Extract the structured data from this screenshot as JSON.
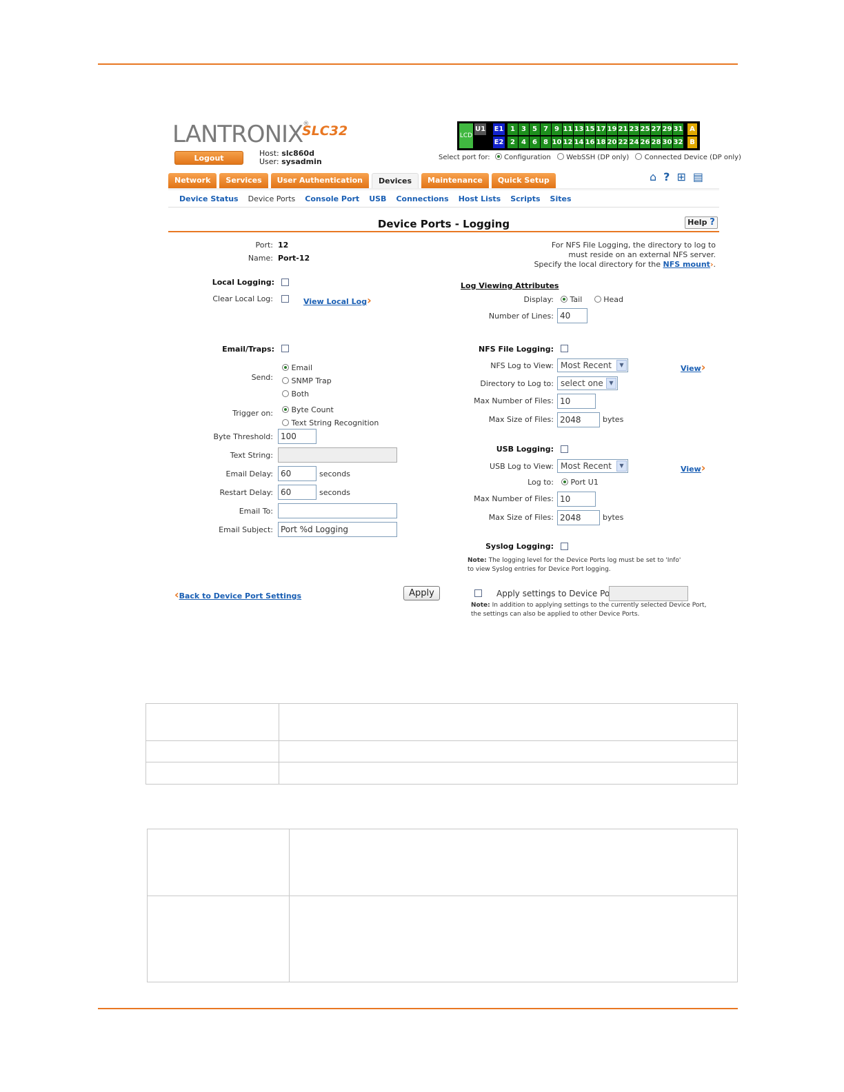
{
  "brand": {
    "logo_main": "LANTRONIX",
    "logo_reg": "®",
    "model": "SLC32"
  },
  "session": {
    "logout_label": "Logout",
    "host_label": "Host:",
    "host_value": "slc860d",
    "user_label": "User:",
    "user_value": "sysadmin"
  },
  "portmap": {
    "lcd": "LCD",
    "u1": "U1",
    "e1": "E1",
    "e2": "E2",
    "top_ports": [
      "1",
      "3",
      "5",
      "7",
      "9",
      "11",
      "13",
      "15",
      "17",
      "19",
      "21",
      "23",
      "25",
      "27",
      "29",
      "31"
    ],
    "bottom_ports": [
      "2",
      "4",
      "6",
      "8",
      "10",
      "12",
      "14",
      "16",
      "18",
      "20",
      "22",
      "24",
      "26",
      "28",
      "30",
      "32"
    ],
    "a": "A",
    "b": "B"
  },
  "select_port": {
    "label": "Select port for:",
    "options": [
      "Configuration",
      "WebSSH (DP only)",
      "Connected Device (DP only)"
    ],
    "selected": "Configuration"
  },
  "tabs": [
    "Network",
    "Services",
    "User Authentication",
    "Devices",
    "Maintenance",
    "Quick Setup"
  ],
  "active_tab": "Devices",
  "icons": [
    "home-icon",
    "help-icon",
    "sitemap-icon",
    "notes-icon"
  ],
  "subnav": [
    "Device Status",
    "Device Ports",
    "Console Port",
    "USB",
    "Connections",
    "Host Lists",
    "Scripts",
    "Sites"
  ],
  "current_subnav": "Device Ports",
  "page": {
    "title": "Device Ports - Logging",
    "help_label": "Help",
    "help_q": "?"
  },
  "port_info": {
    "port_label": "Port:",
    "port_value": "12",
    "name_label": "Name:",
    "name_value": "Port-12"
  },
  "nfs_hint": {
    "line1": "For NFS File Logging, the directory to log to",
    "line2": "must reside on an external NFS server.",
    "line3": "Specify the local directory for the",
    "link": "NFS mount",
    "end": "."
  },
  "local": {
    "local_logging_label": "Local Logging:",
    "clear_label": "Clear Local Log:",
    "view_link": "View Local Log"
  },
  "log_view": {
    "heading": "Log Viewing Attributes",
    "display_label": "Display:",
    "tail": "Tail",
    "head": "Head",
    "display_selected": "Tail",
    "lines_label": "Number of Lines:",
    "lines_value": "40"
  },
  "email": {
    "traps_label": "Email/Traps:",
    "send_label": "Send:",
    "send_options": [
      "Email",
      "SNMP Trap",
      "Both"
    ],
    "send_selected": "Email",
    "trigger_label": "Trigger on:",
    "trigger_options": [
      "Byte Count",
      "Text String Recognition"
    ],
    "trigger_selected": "Byte Count",
    "threshold_label": "Byte Threshold:",
    "threshold_value": "100",
    "text_string_label": "Text String:",
    "text_string_value": "",
    "delay_label": "Email Delay:",
    "delay_value": "60",
    "delay_unit": "seconds",
    "restart_label": "Restart Delay:",
    "restart_value": "60",
    "restart_unit": "seconds",
    "to_label": "Email To:",
    "to_value": "",
    "subject_label": "Email Subject:",
    "subject_value": "Port %d Logging"
  },
  "nfs": {
    "label": "NFS File Logging:",
    "log_view_label": "NFS Log to View:",
    "log_view_value": "Most Recent",
    "view_link": "View",
    "dir_label": "Directory to Log to:",
    "dir_value": "select one",
    "max_files_label": "Max Number of Files:",
    "max_files_value": "10",
    "max_size_label": "Max Size of Files:",
    "max_size_value": "2048",
    "unit": "bytes"
  },
  "usb": {
    "label": "USB Logging:",
    "log_view_label": "USB Log to View:",
    "log_view_value": "Most Recent",
    "view_link": "View",
    "log_to_label": "Log to:",
    "log_to_value": "Port U1",
    "max_files_label": "Max Number of Files:",
    "max_files_value": "10",
    "max_size_label": "Max Size of Files:",
    "max_size_value": "2048",
    "unit": "bytes"
  },
  "syslog": {
    "label": "Syslog Logging:",
    "note_bold": "Note:",
    "note1": "The logging level for the Device Ports log must be set to 'Info'",
    "note2": "to view Syslog entries for Device Port logging."
  },
  "footer": {
    "back_link": "Back to Device Port Settings",
    "apply_label": "Apply",
    "apply_ports_label": "Apply settings to Device Ports:",
    "apply_ports_value": "",
    "note_bold": "Note:",
    "note1": "In addition to applying settings to the currently selected Device Port,",
    "note2": "the settings can also be applied to other Device Ports."
  }
}
